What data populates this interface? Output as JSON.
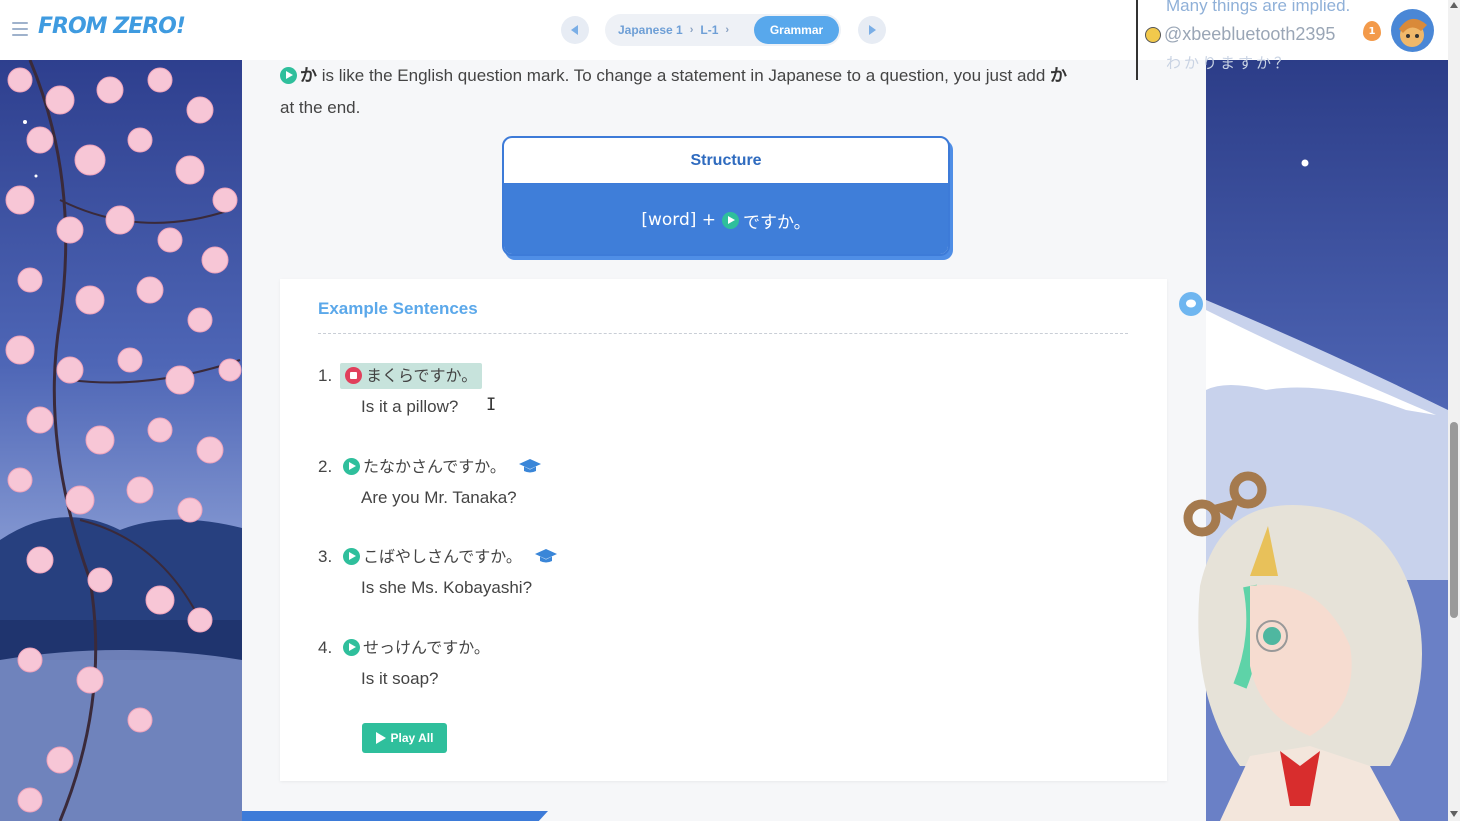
{
  "header": {
    "logo": "FROM ZERO!",
    "breadcrumb": [
      "Japanese 1",
      "L-1"
    ],
    "active_section": "Grammar"
  },
  "intro": {
    "particle": "か",
    "text_before": " is like the English question mark. To change a statement in Japanese to a question, you just add ",
    "particle_end": "か",
    "text_after": "at the end."
  },
  "structure": {
    "title": "Structure",
    "formula_prefix": "[word] +",
    "formula_suffix": "ですか。"
  },
  "examples": {
    "title": "Example Sentences",
    "items": [
      {
        "num": "1.",
        "jp": "まくらですか。",
        "en": "Is it a pillow?",
        "playing": true,
        "has_note": false
      },
      {
        "num": "2.",
        "jp": "たなかさんですか。",
        "en": "Are you Mr. Tanaka?",
        "playing": false,
        "has_note": true
      },
      {
        "num": "3.",
        "jp": "こばやしさんですか。",
        "en": "Is she Ms. Kobayashi?",
        "playing": false,
        "has_note": true
      },
      {
        "num": "4.",
        "jp": "せっけんですか。",
        "en": "Is it soap?",
        "playing": false,
        "has_note": false
      }
    ],
    "play_all_label": "Play All"
  },
  "chat": {
    "previous_message": "Many things are implied.",
    "username": "@xbeebluetooth2395",
    "message": "わかりますか？",
    "badge": "1"
  },
  "colors": {
    "accent_blue": "#3f7ed9",
    "play_green": "#2fbf9c",
    "stop_red": "#e1405c",
    "title_blue": "#5ba8ea"
  },
  "icons": {
    "menu": "hamburger-icon",
    "prev": "chevron-left-icon",
    "next": "chevron-right-icon",
    "play": "play-icon",
    "stop": "stop-icon",
    "note": "graduation-cap-icon",
    "chat": "chat-bubble-icon"
  }
}
